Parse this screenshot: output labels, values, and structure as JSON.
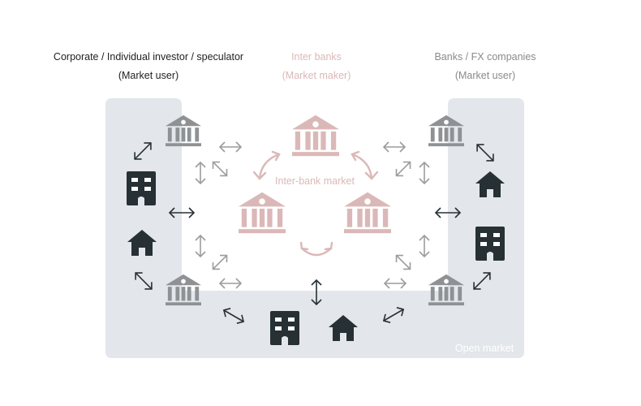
{
  "groups": {
    "left": {
      "title": "Corporate / Individual investor / speculator",
      "role": "(Market user)"
    },
    "center": {
      "title": "Inter banks",
      "role": "(Market maker)"
    },
    "right": {
      "title": "Banks / FX companies",
      "role": "(Market user)"
    }
  },
  "interbank_label": "Inter-bank market",
  "open_market_label": "Open market",
  "icons": {
    "bank": "bank-icon",
    "building": "office-building-icon",
    "house": "house-icon",
    "arrow": "double-arrow-icon"
  },
  "colors": {
    "open_market_bg": "#e3e6ea",
    "dark": "#263035",
    "bank_gray": "#8e9295",
    "interbank_pink": "#dbb8b8",
    "arrow_gray": "#9a9c9e",
    "label_dark": "#222222",
    "label_gray": "#8a8a8a"
  }
}
